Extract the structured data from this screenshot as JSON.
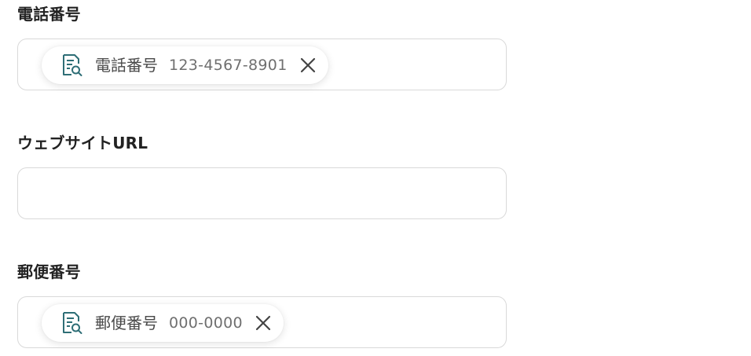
{
  "fields": [
    {
      "label": "電話番号",
      "chip": {
        "name": "電話番号",
        "value": "123-4567-8901",
        "icon": "document-search-icon",
        "remove_icon": "close-icon"
      }
    },
    {
      "label": "ウェブサイトURL",
      "value": ""
    },
    {
      "label": "郵便番号",
      "chip": {
        "name": "郵便番号",
        "value": "000-0000",
        "icon": "document-search-icon",
        "remove_icon": "close-icon"
      }
    }
  ],
  "colors": {
    "icon_accent": "#2e6e76",
    "border": "#d9d9d9",
    "label_text": "#222222"
  }
}
